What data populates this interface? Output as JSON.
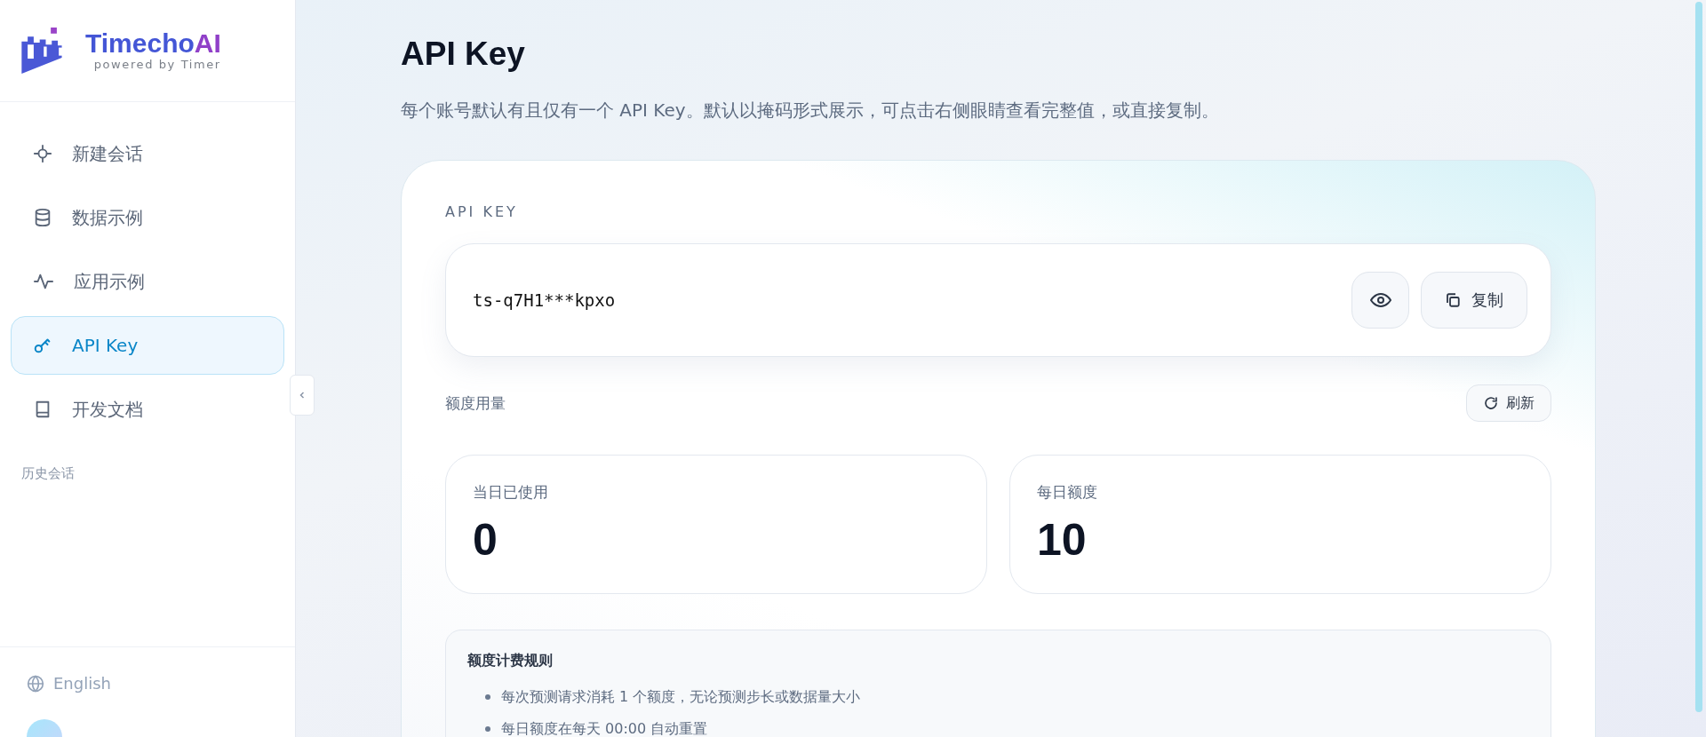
{
  "sidebar": {
    "logo": {
      "name": "Timecho",
      "accent": "AI",
      "tagline": "powered by Timer"
    },
    "nav": [
      {
        "label": "新建会话",
        "selected": false
      },
      {
        "label": "数据示例",
        "selected": false
      },
      {
        "label": "应用示例",
        "selected": false
      },
      {
        "label": "API Key",
        "selected": true
      },
      {
        "label": "开发文档",
        "selected": false
      }
    ],
    "history_heading": "历史会话",
    "language": "English"
  },
  "page": {
    "title": "API Key",
    "description": "每个账号默认有且仅有一个 API Key。默认以掩码形式展示，可点击右侧眼睛查看完整值，或直接复制。"
  },
  "key_card": {
    "label": "API KEY",
    "key": "ts-q7H1***kpxo",
    "copy_button": "复制"
  },
  "usage": {
    "heading": "额度用量",
    "refresh_button": "刷新",
    "stats": [
      {
        "label": "当日已使用",
        "value": "0"
      },
      {
        "label": "每日额度",
        "value": "10"
      }
    ]
  },
  "rules": {
    "title": "额度计费规则",
    "items": [
      "每次预测请求消耗 1 个额度，无论预测步长或数据量大小",
      "每日额度在每天 00:00 自动重置"
    ]
  }
}
